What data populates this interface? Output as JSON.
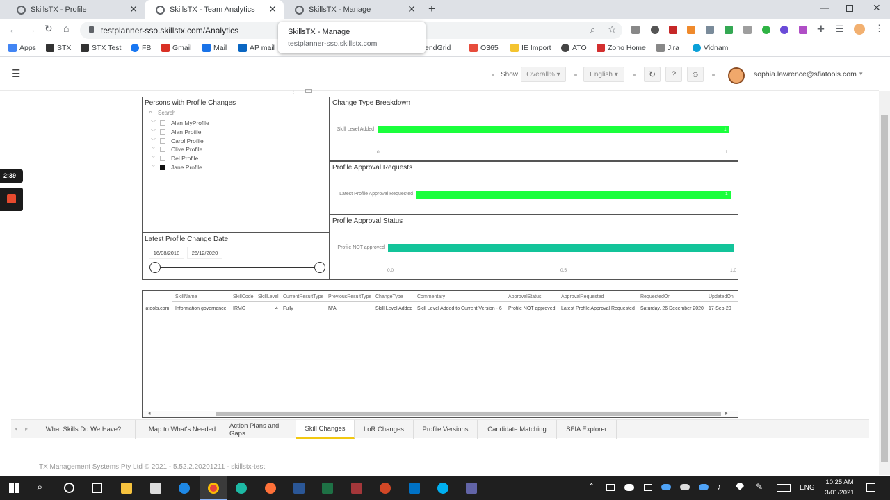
{
  "browser": {
    "tabs": [
      {
        "title": "SkillsTX - Profile"
      },
      {
        "title": "SkillsTX - Team Analytics"
      },
      {
        "title": "SkillsTX - Manage"
      }
    ],
    "url": "testplanner-sso.skillstx.com/Analytics",
    "tooltip": {
      "title": "SkillsTX - Manage",
      "url": "testplanner-sso.skillstx.com"
    },
    "bookmarks": [
      {
        "label": "Apps",
        "color": "#4285f4"
      },
      {
        "label": "STX",
        "color": "#333333"
      },
      {
        "label": "STX Test",
        "color": "#333333"
      },
      {
        "label": "FB",
        "color": "#1877f2"
      },
      {
        "label": "Gmail",
        "color": "#d93025"
      },
      {
        "label": "Mail",
        "color": "#1a73e8"
      },
      {
        "label": "AP mail",
        "color": "#0a66c2"
      },
      {
        "label": "SendGrid",
        "color": "#1a82e2"
      },
      {
        "label": "O365",
        "color": "#e74c3c"
      },
      {
        "label": "IE Import",
        "color": "#f4c430"
      },
      {
        "label": "ATO",
        "color": "#444444"
      },
      {
        "label": "Zoho Home",
        "color": "#d32f2f"
      },
      {
        "label": "Jira",
        "color": "#888888"
      },
      {
        "label": "Vidnami",
        "color": "#0aa0d8"
      }
    ]
  },
  "header": {
    "show_label": "Show",
    "show_value": "Overall%",
    "language": "English",
    "user": "sophia.lawrence@sfiatools.com"
  },
  "recorder": {
    "time": "2:39"
  },
  "persons_panel": {
    "title": "Persons with Profile Changes",
    "search_placeholder": "Search",
    "items": [
      {
        "label": "Alan MyProfile",
        "checked": false
      },
      {
        "label": "Alan Profile",
        "checked": false
      },
      {
        "label": "Carol Profile",
        "checked": false
      },
      {
        "label": "Clive Profile",
        "checked": false
      },
      {
        "label": "Del Profile",
        "checked": false
      },
      {
        "label": "Jane Profile",
        "checked": true
      }
    ]
  },
  "date_panel": {
    "title": "Latest Profile Change Date",
    "from": "16/08/2018",
    "to": "26/12/2020"
  },
  "chart_data": [
    {
      "type": "bar",
      "title": "Change Type Breakdown",
      "categories": [
        "Skill Level Added"
      ],
      "values": [
        1
      ],
      "data_labels": [
        "1"
      ],
      "xlim": [
        0,
        1
      ],
      "ticks": [
        "0",
        "1"
      ],
      "color": "#1aff3c"
    },
    {
      "type": "bar",
      "title": "Profile Approval Requests",
      "categories": [
        "Latest Profile Approval Requested"
      ],
      "values": [
        1
      ],
      "data_labels": [
        "1"
      ],
      "color": "#1aff3c"
    },
    {
      "type": "bar",
      "title": "Profile Approval Status",
      "categories": [
        "Profile NOT approved"
      ],
      "values": [
        1.0
      ],
      "xlim": [
        0,
        1
      ],
      "ticks": [
        "0.0",
        "0.5",
        "1.0"
      ],
      "color": "#13c49a"
    }
  ],
  "table": {
    "headers": [
      "SkillName",
      "SkillCode",
      "SkillLevel",
      "CurrentResultType",
      "PreviousResultType",
      "ChangeType",
      "Commentary",
      "ApprovalStatus",
      "ApprovalRequested",
      "RequestedOn",
      "UpdatedOn"
    ],
    "row": {
      "email_frag": "iatools.com",
      "skill_name": "Information governance",
      "skill_code": "IRMG",
      "skill_level": "4",
      "current": "Fully",
      "previous": "N/A",
      "change_type": "Skill Level Added",
      "commentary": "Skill Level Added to Current Version - 6",
      "approval_status": "Profile NOT approved",
      "approval_requested": "Latest Profile Approval Requested",
      "requested_on": "Saturday, 26 December 2020",
      "updated_on": "17-Sep-20"
    }
  },
  "page_tabs": [
    {
      "label": "What Skills Do We Have?"
    },
    {
      "label": "Map to What's Needed"
    },
    {
      "label": "Action Plans and Gaps"
    },
    {
      "label": "Skill Changes"
    },
    {
      "label": "LoR Changes"
    },
    {
      "label": "Profile Versions"
    },
    {
      "label": "Candidate Matching"
    },
    {
      "label": "SFIA Explorer"
    }
  ],
  "footer": "TX Management Systems Pty Ltd © 2021 - 5.52.2.20201211 - skillstx-test",
  "taskbar": {
    "time": "10:25 AM",
    "date": "3/01/2021",
    "lang": "ENG"
  }
}
